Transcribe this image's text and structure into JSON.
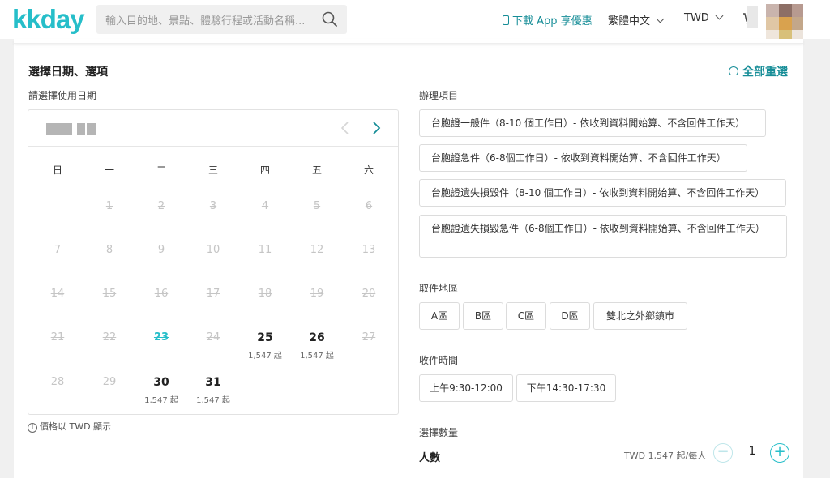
{
  "header": {
    "logo": "kkday",
    "search_placeholder": "輸入目的地、景點、體驗行程或活動名稱...",
    "app_promo": "下載 App 享優惠",
    "language": "繁體中文",
    "currency": "TWD"
  },
  "booking": {
    "title": "選擇日期、選項",
    "reset_label": "全部重選",
    "date_label": "請選擇使用日期",
    "price_note": "價格以 TWD 顯示"
  },
  "calendar": {
    "weekdays": [
      "日",
      "一",
      "二",
      "三",
      "四",
      "五",
      "六"
    ],
    "days": [
      {
        "n": "1",
        "price": "",
        "state": "off"
      },
      {
        "n": "2",
        "price": "",
        "state": "off"
      },
      {
        "n": "3",
        "price": "",
        "state": "off"
      },
      {
        "n": "4",
        "price": "",
        "state": "off"
      },
      {
        "n": "5",
        "price": "",
        "state": "off"
      },
      {
        "n": "6",
        "price": "",
        "state": "off"
      },
      {
        "n": "7",
        "price": "",
        "state": "off"
      },
      {
        "n": "8",
        "price": "",
        "state": "off"
      },
      {
        "n": "9",
        "price": "",
        "state": "off"
      },
      {
        "n": "10",
        "price": "",
        "state": "off"
      },
      {
        "n": "11",
        "price": "",
        "state": "off"
      },
      {
        "n": "12",
        "price": "",
        "state": "off"
      },
      {
        "n": "13",
        "price": "",
        "state": "off"
      },
      {
        "n": "14",
        "price": "",
        "state": "off"
      },
      {
        "n": "15",
        "price": "",
        "state": "off"
      },
      {
        "n": "16",
        "price": "",
        "state": "off"
      },
      {
        "n": "17",
        "price": "",
        "state": "off"
      },
      {
        "n": "18",
        "price": "",
        "state": "off"
      },
      {
        "n": "19",
        "price": "",
        "state": "off"
      },
      {
        "n": "20",
        "price": "",
        "state": "off"
      },
      {
        "n": "21",
        "price": "",
        "state": "off"
      },
      {
        "n": "22",
        "price": "",
        "state": "off"
      },
      {
        "n": "23",
        "price": "",
        "state": "today"
      },
      {
        "n": "24",
        "price": "",
        "state": "off"
      },
      {
        "n": "25",
        "price": "1,547 起",
        "state": "avail"
      },
      {
        "n": "26",
        "price": "1,547 起",
        "state": "avail"
      },
      {
        "n": "27",
        "price": "",
        "state": "off"
      },
      {
        "n": "28",
        "price": "",
        "state": "off"
      },
      {
        "n": "29",
        "price": "",
        "state": "off"
      },
      {
        "n": "30",
        "price": "1,547 起",
        "state": "avail"
      },
      {
        "n": "31",
        "price": "1,547 起",
        "state": "avail"
      }
    ]
  },
  "service": {
    "label": "辦理項目",
    "options": [
      "台胞證一般件（8-10 個工作日）- 依收到資料開始算、不含回件工作天）",
      "台胞證急件（6-8個工作日）- 依收到資料開始算、不含回件工作天）",
      "台胞證遺失損毀件（8-10 個工作日）- 依收到資料開始算、不含回件工作天）",
      "台胞證遺失損毀急件（6-8個工作日）- 依收到資料開始算、不含回件工作天）"
    ]
  },
  "pickup": {
    "label": "取件地區",
    "options": [
      "A區",
      "B區",
      "C區",
      "D區",
      "雙北之外鄉鎮市"
    ]
  },
  "collect": {
    "label": "收件時間",
    "options": [
      "上午9:30-12:00",
      "下午14:30-17:30"
    ]
  },
  "quantity": {
    "label": "選擇數量",
    "row_label": "人數",
    "price": "TWD 1,547 起/每人",
    "value": "1",
    "minus": "−",
    "plus": "+"
  },
  "colors": {
    "brand": "#26bec9",
    "brand_dark": "#168d97",
    "disabled": "#c5c5c5"
  }
}
